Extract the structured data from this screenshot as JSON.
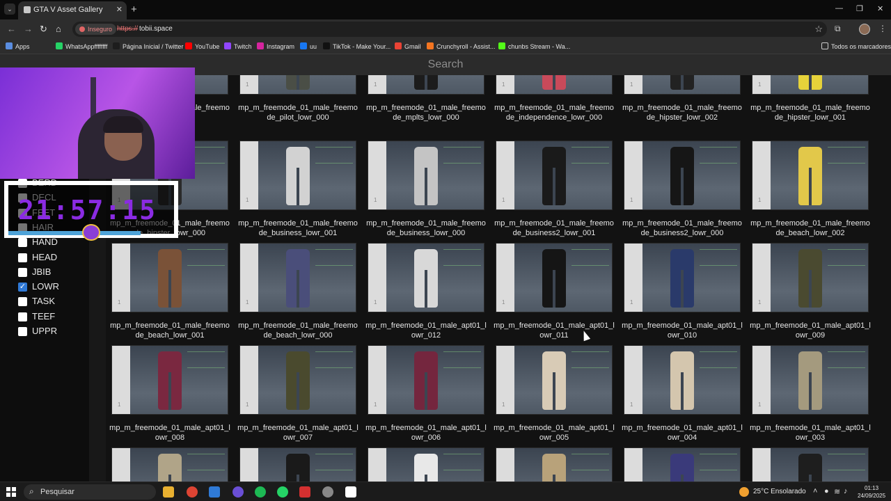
{
  "browser": {
    "tab_title": "GTA V Asset Gallery",
    "new_tab": "+",
    "close_tab": "✕",
    "security_label": "Inseguro",
    "url_scheme": "https://",
    "url_host": "tobii.space",
    "bookmarks": [
      {
        "label": "Apps",
        "color": "#5a8de0"
      },
      {
        "label": "WhatsAppffffffff",
        "color": "#25d366"
      },
      {
        "label": "Página Inicial / Twitter",
        "color": "#1d1d1d"
      },
      {
        "label": "YouTube",
        "color": "#ff0000"
      },
      {
        "label": "Twitch",
        "color": "#9146ff"
      },
      {
        "label": "Instagram",
        "color": "#d6249f"
      },
      {
        "label": "uu",
        "color": "#1877f2"
      },
      {
        "label": "TikTok - Make Your...",
        "color": "#111111"
      },
      {
        "label": "Gmail",
        "color": "#ea4335"
      },
      {
        "label": "Crunchyroll - Assist...",
        "color": "#f47521"
      },
      {
        "label": "chunbs Stream - Wa...",
        "color": "#53fc18"
      }
    ],
    "all_bookmarks": "Todos os marcadores"
  },
  "search": {
    "placeholder": "Search"
  },
  "filters": [
    {
      "label": "BERD",
      "checked": false
    },
    {
      "label": "DECL",
      "checked": false
    },
    {
      "label": "FEET",
      "checked": false
    },
    {
      "label": "HAIR",
      "checked": false
    },
    {
      "label": "HAND",
      "checked": false
    },
    {
      "label": "HEAD",
      "checked": false
    },
    {
      "label": "JBIB",
      "checked": false
    },
    {
      "label": "LOWR",
      "checked": true
    },
    {
      "label": "TASK",
      "checked": false
    },
    {
      "label": "TEEF",
      "checked": false
    },
    {
      "label": "UPPR",
      "checked": false
    }
  ],
  "assets": [
    {
      "name": "mp_m_freemode_01_male_freemode_...000",
      "color": "#3a3a3a"
    },
    {
      "name": "mp_m_freemode_01_male_freemode_pilot_lowr_000",
      "color": "#4a4e46"
    },
    {
      "name": "mp_m_freemode_01_male_freemode_mplts_lowr_000",
      "color": "#1c1c1c"
    },
    {
      "name": "mp_m_freemode_01_male_freemode_independence_lowr_000",
      "color": "#c84a5a"
    },
    {
      "name": "mp_m_freemode_01_male_freemode_hipster_lowr_002",
      "color": "#222222"
    },
    {
      "name": "mp_m_freemode_01_male_freemode_hipster_lowr_001",
      "color": "#e6d23a"
    },
    {
      "name": "mp_m_freemode_01_male_freemode_hipster_lowr_000",
      "color": "#2a2a2a"
    },
    {
      "name": "mp_m_freemode_01_male_freemode_business_lowr_001",
      "color": "#d2d2d2"
    },
    {
      "name": "mp_m_freemode_01_male_freemode_business_lowr_000",
      "color": "#c4c4c4"
    },
    {
      "name": "mp_m_freemode_01_male_freemode_business2_lowr_001",
      "color": "#1a1a1a"
    },
    {
      "name": "mp_m_freemode_01_male_freemode_business2_lowr_000",
      "color": "#161616"
    },
    {
      "name": "mp_m_freemode_01_male_freemode_beach_lowr_002",
      "color": "#e2c84a"
    },
    {
      "name": "mp_m_freemode_01_male_freemode_beach_lowr_001",
      "color": "#7a5238"
    },
    {
      "name": "mp_m_freemode_01_male_freemode_beach_lowr_000",
      "color": "#4a4e7a"
    },
    {
      "name": "mp_m_freemode_01_male_apt01_lowr_012",
      "color": "#d8d8d8"
    },
    {
      "name": "mp_m_freemode_01_male_apt01_lowr_011",
      "color": "#151515"
    },
    {
      "name": "mp_m_freemode_01_male_apt01_lowr_010",
      "color": "#2a3a6a"
    },
    {
      "name": "mp_m_freemode_01_male_apt01_lowr_009",
      "color": "#4a4a30"
    },
    {
      "name": "mp_m_freemode_01_male_apt01_lowr_008",
      "color": "#7a2840"
    },
    {
      "name": "mp_m_freemode_01_male_apt01_lowr_007",
      "color": "#4a4a2e"
    },
    {
      "name": "mp_m_freemode_01_male_apt01_lowr_006",
      "color": "#74263e"
    },
    {
      "name": "mp_m_freemode_01_male_apt01_lowr_005",
      "color": "#d8cbb6"
    },
    {
      "name": "mp_m_freemode_01_male_apt01_lowr_004",
      "color": "#d4c6ae"
    },
    {
      "name": "mp_m_freemode_01_male_apt01_lowr_003",
      "color": "#a49a7e"
    },
    {
      "name": "",
      "color": "#b0a488"
    },
    {
      "name": "",
      "color": "#1a1a1a"
    },
    {
      "name": "",
      "color": "#e8e8e8"
    },
    {
      "name": "",
      "color": "#b8a27a"
    },
    {
      "name": "",
      "color": "#3a3a7a"
    },
    {
      "name": "",
      "color": "#1e1e1e"
    }
  ],
  "overlay": {
    "clock": "21:57:15"
  },
  "taskbar": {
    "search_placeholder": "Pesquisar",
    "weather": "25°C  Ensolarado",
    "time": "01:13",
    "date": "24/09/2025"
  }
}
